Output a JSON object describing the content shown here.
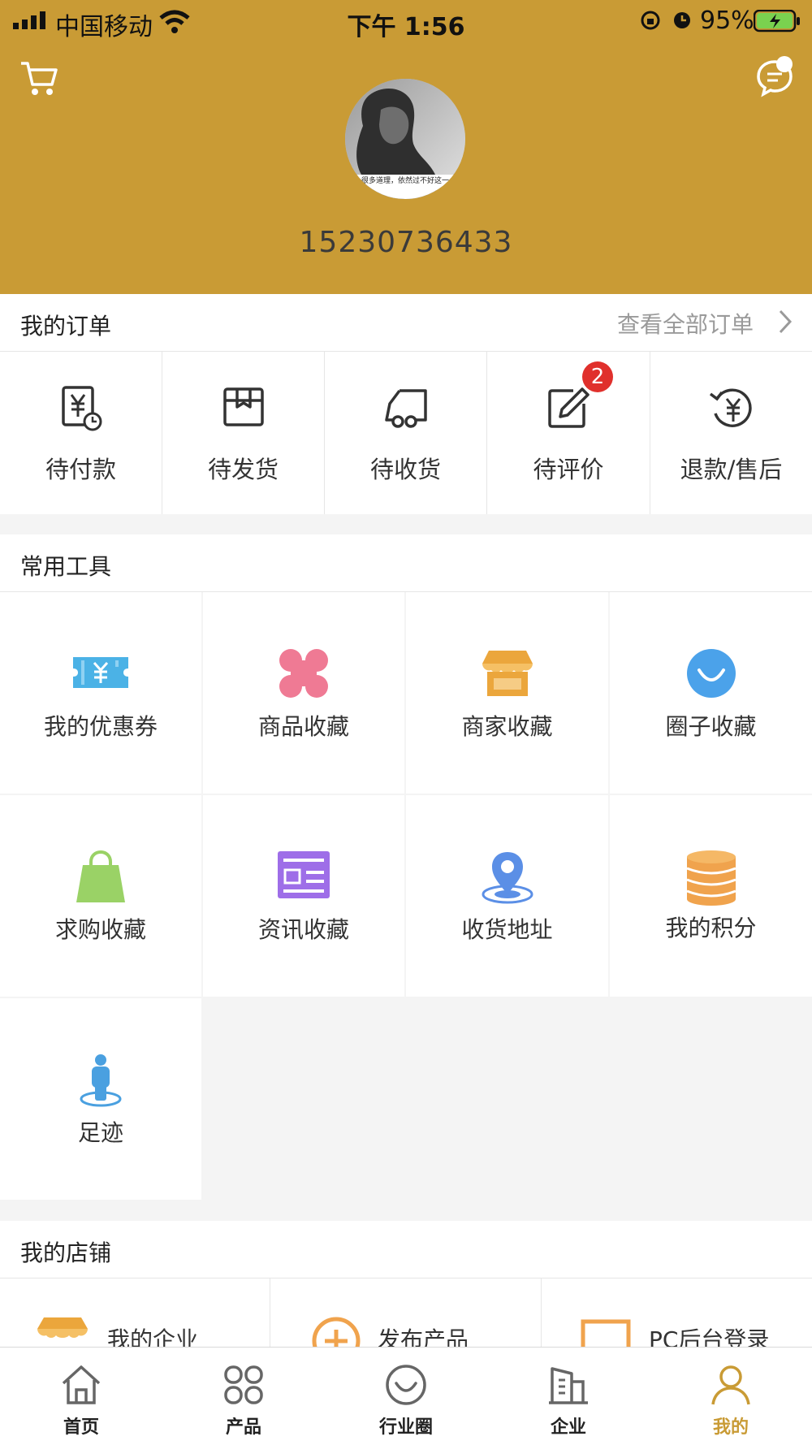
{
  "status_bar": {
    "carrier": "中国移动",
    "time": "下午 1:56",
    "battery": "95%"
  },
  "header": {
    "phone": "15230736433",
    "avatar_caption": "很多道理，依然过不好这一"
  },
  "orders": {
    "title": "我的订单",
    "view_all": "查看全部订单",
    "items": [
      {
        "label": "待付款",
        "icon": "yuan-clock-icon"
      },
      {
        "label": "待发货",
        "icon": "package-icon"
      },
      {
        "label": "待收货",
        "icon": "truck-icon"
      },
      {
        "label": "待评价",
        "icon": "edit-icon",
        "badge": "2"
      },
      {
        "label": "退款/售后",
        "icon": "refund-icon"
      }
    ]
  },
  "tools": {
    "title": "常用工具",
    "items": [
      {
        "label": "我的优惠券",
        "icon": "coupon-icon",
        "color": "#4bb2e6"
      },
      {
        "label": "商品收藏",
        "icon": "clover-icon",
        "color": "#ef7a94"
      },
      {
        "label": "商家收藏",
        "icon": "shop-icon",
        "color": "#eba63c"
      },
      {
        "label": "圈子收藏",
        "icon": "smile-circle-icon",
        "color": "#4ba2ea"
      },
      {
        "label": "求购收藏",
        "icon": "bag-icon",
        "color": "#9ad266"
      },
      {
        "label": "资讯收藏",
        "icon": "news-icon",
        "color": "#9e6ee8"
      },
      {
        "label": "收货地址",
        "icon": "location-icon",
        "color": "#5b8fe6"
      },
      {
        "label": "我的积分",
        "icon": "coins-icon",
        "color": "#f0a34d"
      },
      {
        "label": "足迹",
        "icon": "footprint-icon",
        "color": "#4aa0e0"
      }
    ]
  },
  "shop": {
    "title": "我的店铺",
    "items": [
      {
        "label": "我的企业",
        "icon": "shop-icon"
      },
      {
        "label": "发布产品",
        "icon": "plus-circle-icon"
      },
      {
        "label": "PC后台登录",
        "icon": "laptop-icon"
      }
    ]
  },
  "tabbar": {
    "items": [
      {
        "label": "首页",
        "icon": "home-icon"
      },
      {
        "label": "产品",
        "icon": "grid-icon"
      },
      {
        "label": "行业圈",
        "icon": "smile-icon"
      },
      {
        "label": "企业",
        "icon": "building-icon"
      },
      {
        "label": "我的",
        "icon": "user-icon",
        "active": true
      }
    ],
    "active_color": "#c99b35"
  }
}
